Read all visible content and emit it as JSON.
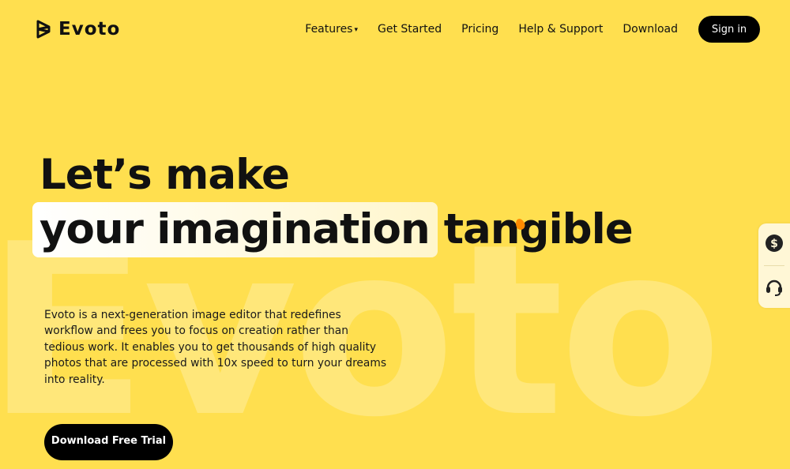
{
  "brand": {
    "name": "Evoto",
    "watermark": "Evoto"
  },
  "nav": {
    "items": [
      {
        "label": "Features",
        "has_dropdown": true
      },
      {
        "label": "Get Started"
      },
      {
        "label": "Pricing"
      },
      {
        "label": "Help & Support"
      },
      {
        "label": "Download"
      }
    ],
    "caret": "▾",
    "signin_label": "Sign in"
  },
  "hero": {
    "line1": "Let’s make",
    "highlight": "your imagination",
    "line2_rest": "tangible",
    "description": "Evoto is a next-generation image editor that redefines workflow and frees you to focus on creation rather than tedious work. It enables you to get thousands of high quality photos that are processed with 10x speed to turn your dreams into reality.",
    "cta_label": "Download Free Trial"
  },
  "side_panel": {
    "items": [
      {
        "icon": "dollar-icon"
      },
      {
        "icon": "headset-icon"
      }
    ]
  },
  "colors": {
    "background": "#FFDF4F",
    "watermark": "#FFE77A",
    "accent_cursor": "#FF8A00",
    "button": "#000000"
  }
}
